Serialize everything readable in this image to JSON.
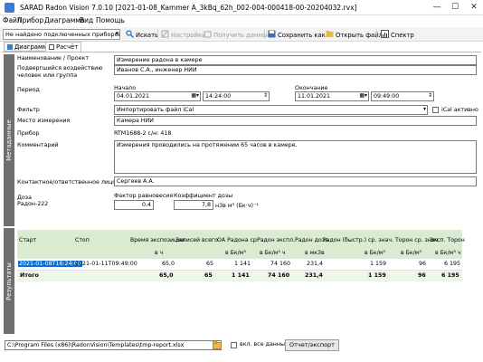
{
  "window": {
    "title": "SARAD Radon Vision 7.0.10 [2021-01-08_Kammer A_3kBq_62h_002-004-000418-00-20204032.rvx]",
    "minimize": "—",
    "maximize": "☐",
    "close": "✕"
  },
  "menu": [
    "Файл",
    "Прибор",
    "Диаграмма",
    "Вид",
    "Помощь"
  ],
  "toolbar": {
    "device_select": "Не найдено подключенных приборов",
    "search": "Искать",
    "settings": "Настройки",
    "get_data": "Получить данные",
    "save_as": "Сохранить как...",
    "open_file": "Открыть файл",
    "spectrum": "Спектр"
  },
  "tabs": [
    "Диаграмма",
    "Расчёт"
  ],
  "metadata_label": "Метаданные",
  "results_label": "Результаты",
  "form": {
    "name_label": "Наименование / Проект",
    "name_value": "Измерение радона в камере",
    "exposed_label": "Подвергшийся воздействию человек или группа",
    "exposed_value": "Иванов С.А., инженер НИИ",
    "period_label": "Период",
    "start_label": "Начало",
    "end_label": "Окончание",
    "start_date": "04.01.2021",
    "start_time": "14:24:00",
    "end_date": "11.01.2021",
    "end_time": "09:49:00",
    "filter_label": "Фильтр",
    "filter_value": "Импортировать файл iCal",
    "ical_label": "iCal активно",
    "location_label": "Место измерения",
    "location_value": "Камера НИИ",
    "device_label": "Прибор",
    "device_value": "RTM1688-2 с/н: 418",
    "comment_label": "Комментарий",
    "comment_value": "Измерения проводились на протяжении 65 часов в камере.",
    "contact_label": "Контактное/ответственное лицо",
    "contact_value": "Сергеев А.А.",
    "dose_label": "Доза",
    "dose_sub": "Радон-222",
    "eq_label": "Фактор равновесия",
    "eq_value": "0,4",
    "coef_label": "Коэффициент дозы",
    "coef_value": "7,8",
    "coef_unit": "нЗв м³ (Бк·ч)⁻¹"
  },
  "table": {
    "headers": [
      "Старт",
      "Стоп",
      "Время экспозиции",
      "Записей всего",
      "ОА Радона ср.",
      "Радон экспл.",
      "Радон доза",
      "Радон (быстр.) ср. знач.",
      "Торон ср. знач.",
      "Эксп. Торон"
    ],
    "units": [
      "",
      "",
      "в ч",
      "",
      "в Бк/м³",
      "в Бк/м³ ч",
      "в мкЗв",
      "в Бк/м³",
      "в Бк/м³",
      "в Бк/м³ ч"
    ],
    "row": [
      "2021-01-08T16:24:00",
      "2021-01-11T09:49:00",
      "65,0",
      "65",
      "1 141",
      "74 160",
      "231,4",
      "1 159",
      "96",
      "6 195"
    ],
    "total": [
      "Итого",
      "",
      "65,0",
      "65",
      "1 141",
      "74 160",
      "231,4",
      "1 159",
      "96",
      "6 195"
    ]
  },
  "bottom": {
    "path": "C:\\Program Files (x86)\\RadonVision\\Templates\\tmp-report.xlsx",
    "include_all": "вкл. все данные",
    "export": "Отчет/экспорт"
  },
  "colors": {
    "sidebar": "#6f6f6f",
    "table_header": "#d9ecd2",
    "selection": "#0e6fd6"
  }
}
